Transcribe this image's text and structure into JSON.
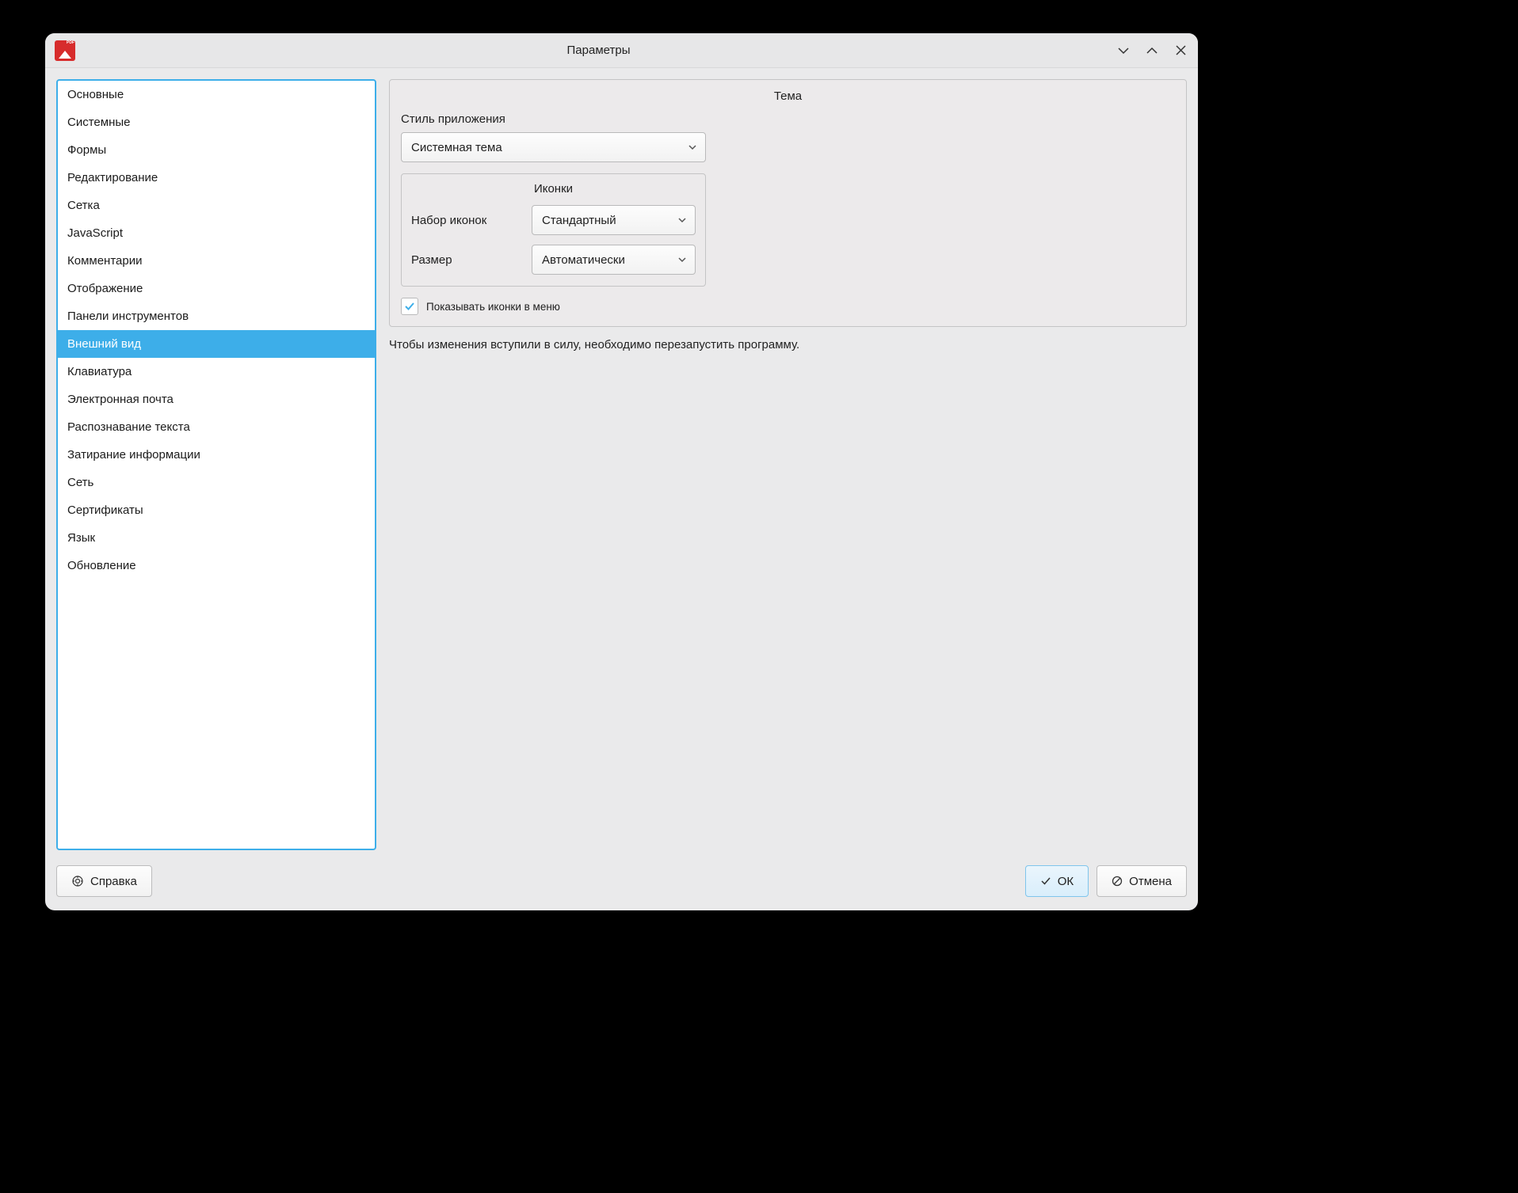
{
  "window": {
    "title": "Параметры"
  },
  "sidebar": {
    "items": [
      "Основные",
      "Системные",
      "Формы",
      "Редактирование",
      "Сетка",
      "JavaScript",
      "Комментарии",
      "Отображение",
      "Панели инструментов",
      "Внешний вид",
      "Клавиатура",
      "Электронная почта",
      "Распознавание текста",
      "Затирание информации",
      "Сеть",
      "Сертификаты",
      "Язык",
      "Обновление"
    ],
    "selected_index": 9
  },
  "main": {
    "theme_group_title": "Тема",
    "app_style_label": "Стиль приложения",
    "app_style_value": "Системная тема",
    "icons_group_title": "Иконки",
    "icon_set_label": "Набор иконок",
    "icon_set_value": "Стандартный",
    "icon_size_label": "Размер",
    "icon_size_value": "Автоматически",
    "show_icons_checkbox_label": "Показывать иконки в меню",
    "show_icons_checked": true,
    "restart_note": "Чтобы изменения вступили в силу, необходимо перезапустить программу."
  },
  "footer": {
    "help_label": "Справка",
    "ok_label": "ОК",
    "cancel_label": "Отмена"
  }
}
